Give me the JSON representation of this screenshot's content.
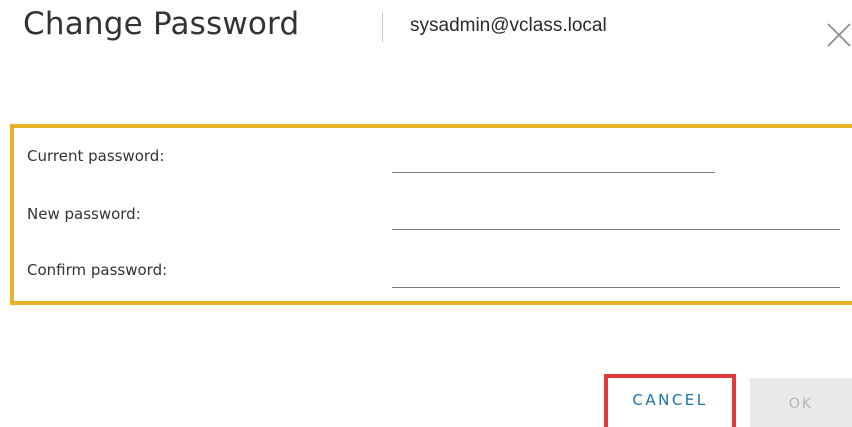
{
  "dialog": {
    "title": "Change Password",
    "account": "sysadmin@vclass.local",
    "close_label": "×"
  },
  "form": {
    "fields": [
      {
        "label": "Current password:",
        "value": ""
      },
      {
        "label": "New password:",
        "value": ""
      },
      {
        "label": "Confirm password:",
        "value": ""
      }
    ]
  },
  "actions": {
    "cancel_label": "CANCEL",
    "ok_label": "OK"
  },
  "colors": {
    "highlight_box": "#e8b12a",
    "cancel_highlight": "#e23a3a",
    "cancel_text": "#1a74a8",
    "ok_disabled_bg": "#e9e9e9",
    "ok_disabled_text": "#b5b5b5"
  }
}
